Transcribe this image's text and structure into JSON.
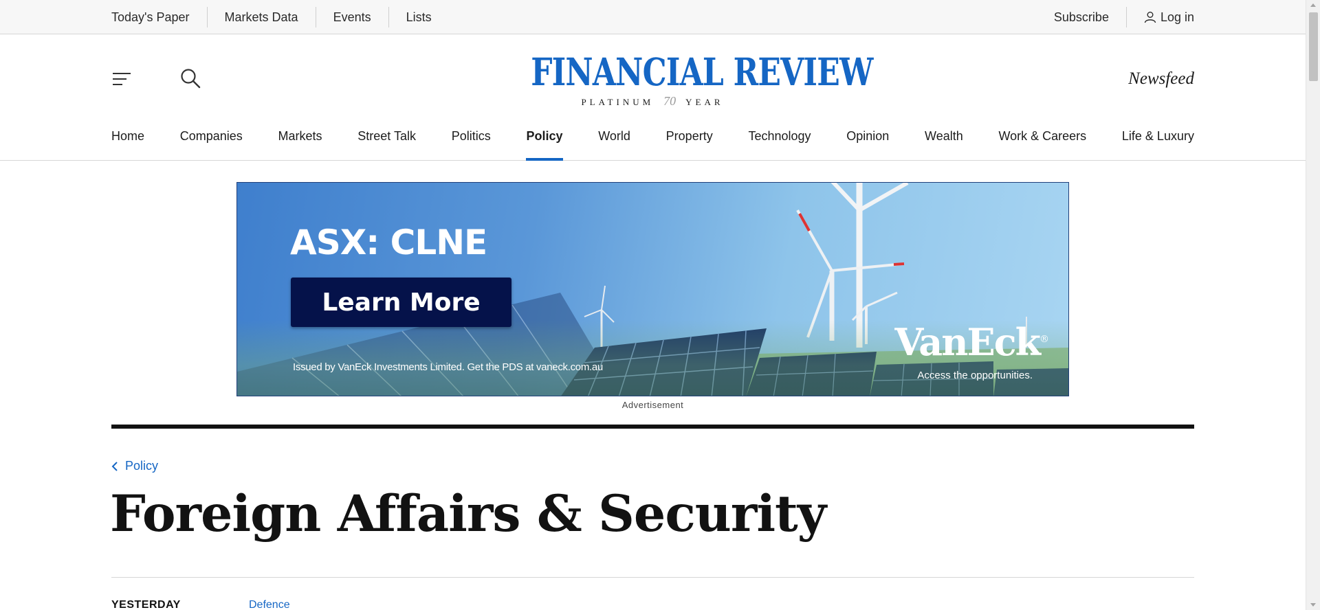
{
  "utility_bar": {
    "links": [
      "Today's Paper",
      "Markets Data",
      "Events",
      "Lists"
    ],
    "subscribe_label": "Subscribe",
    "login_label": "Log in"
  },
  "masthead": {
    "logo_title": "FINANCIAL REVIEW",
    "logo_sub_left": "PLATINUM",
    "logo_sub_number": "70",
    "logo_sub_right": "YEAR",
    "newsfeed_label": "Newsfeed",
    "icons": [
      "menu-icon",
      "search-icon",
      "user-icon"
    ]
  },
  "main_nav": {
    "items": [
      {
        "label": "Home",
        "active": false
      },
      {
        "label": "Companies",
        "active": false
      },
      {
        "label": "Markets",
        "active": false
      },
      {
        "label": "Street Talk",
        "active": false
      },
      {
        "label": "Politics",
        "active": false
      },
      {
        "label": "Policy",
        "active": true
      },
      {
        "label": "World",
        "active": false
      },
      {
        "label": "Property",
        "active": false
      },
      {
        "label": "Technology",
        "active": false
      },
      {
        "label": "Opinion",
        "active": false
      },
      {
        "label": "Wealth",
        "active": false
      },
      {
        "label": "Work & Careers",
        "active": false
      },
      {
        "label": "Life & Luxury",
        "active": false
      }
    ]
  },
  "ad": {
    "headline": "ASX: CLNE",
    "cta_label": "Learn More",
    "disclaimer": "Issued by VanEck Investments Limited. Get the PDS at vaneck.com.au",
    "brand": "VanEck",
    "brand_mark": "®",
    "tagline": "Access the opportunities.",
    "label": "Advertisement"
  },
  "section": {
    "breadcrumb": "Policy",
    "title": "Foreign Affairs & Security",
    "first_story": {
      "date": "YESTERDAY",
      "tag": "Defence"
    }
  },
  "colors": {
    "brand_blue": "#1566c4",
    "ad_cta_bg": "#05124a",
    "text": "#121212"
  }
}
